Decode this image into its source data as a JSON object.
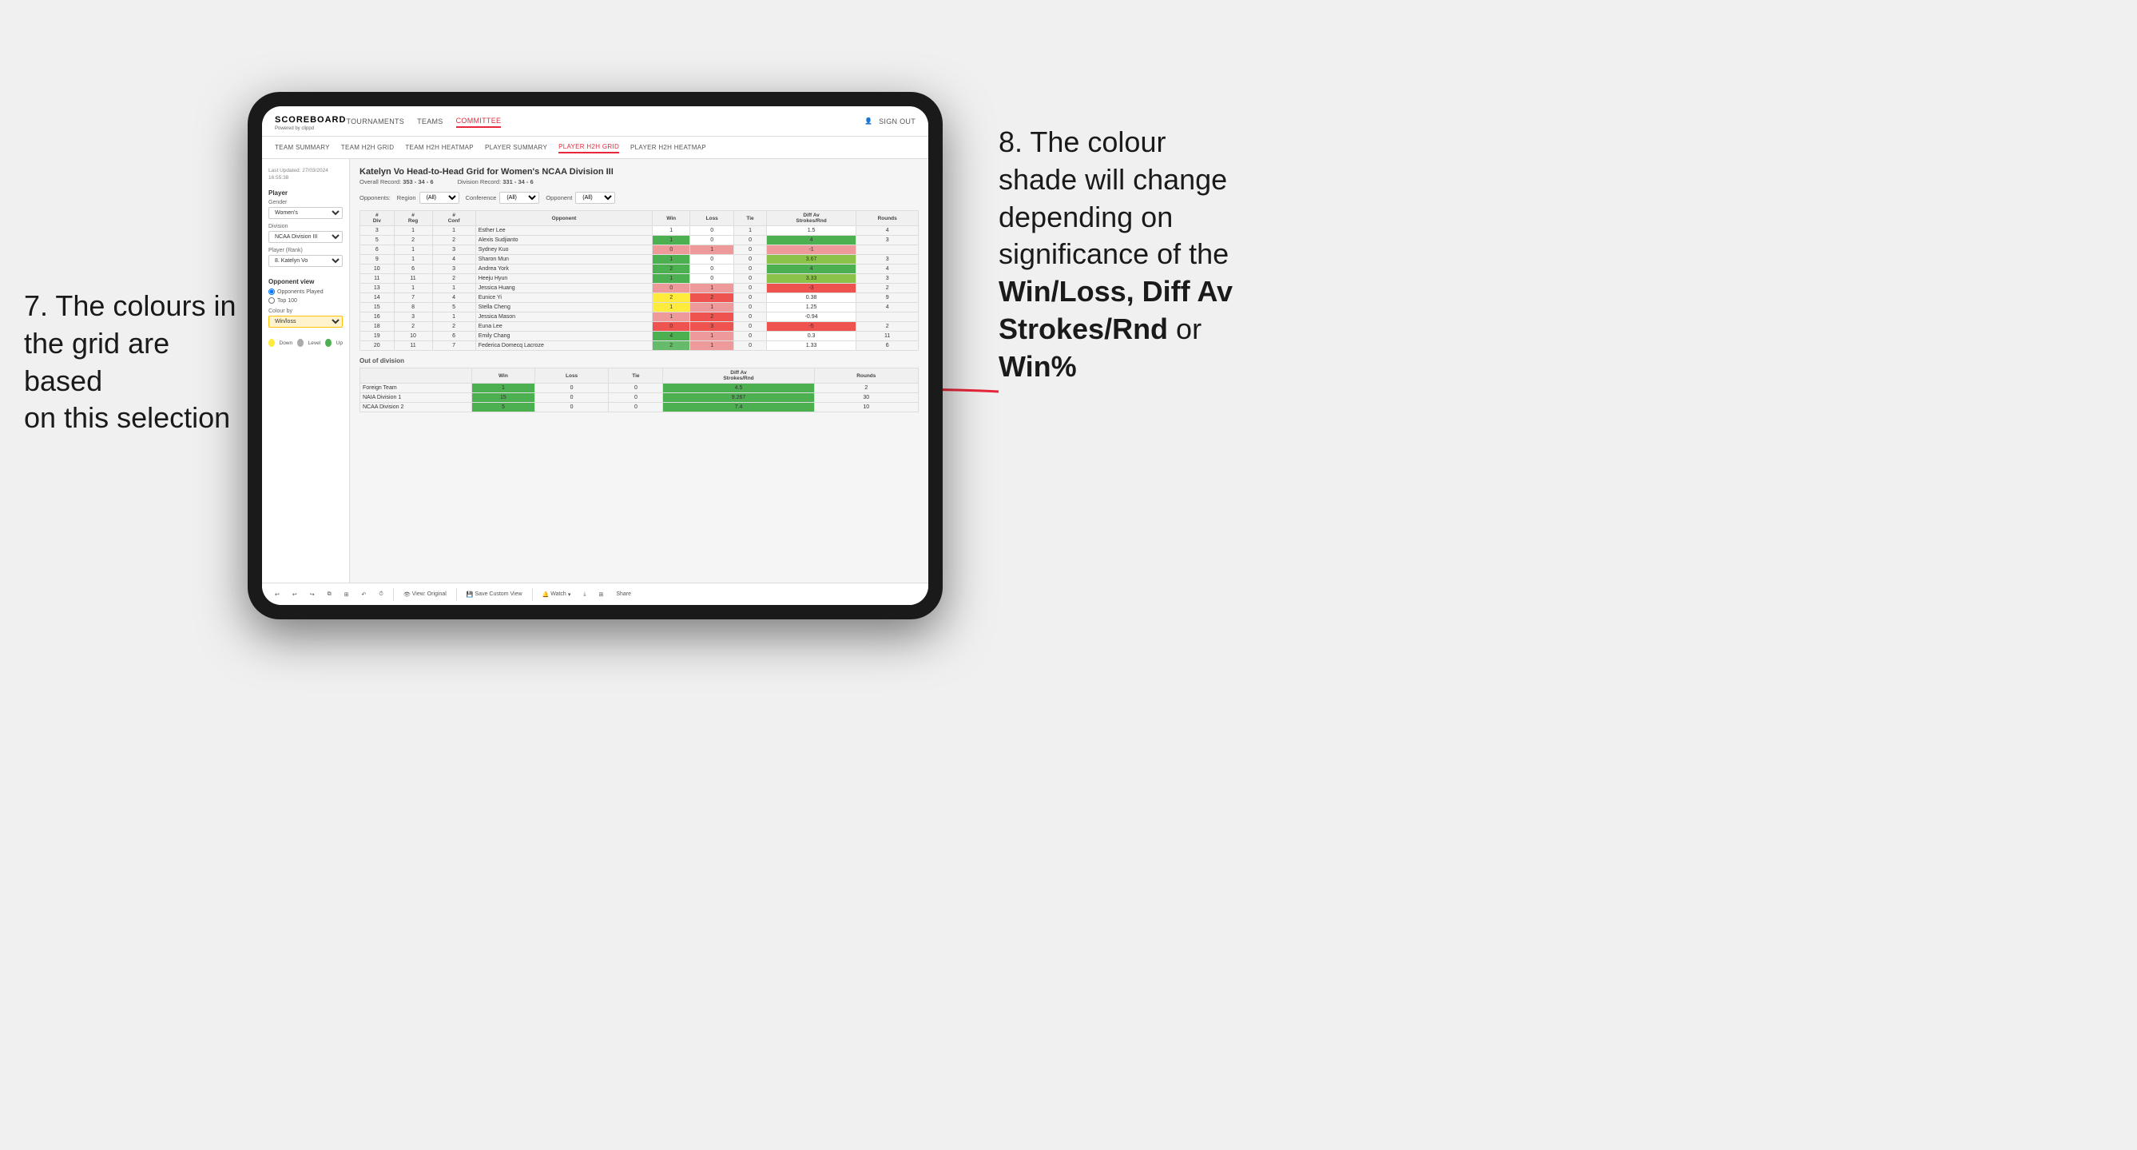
{
  "annotations": {
    "left_title": "7. The colours in\nthe grid are based\non this selection",
    "right_title_line1": "8. The colour",
    "right_title_line2": "shade will change",
    "right_title_line3": "depending on",
    "right_title_line4": "significance of the",
    "right_title_bold1": "Win/Loss,",
    "right_title_bold2": "Diff Av",
    "right_title_bold3": "Strokes/Rnd",
    "right_title_or": "or",
    "right_title_bold4": "Win%"
  },
  "app": {
    "logo": "SCOREBOARD",
    "logo_sub": "Powered by clippd",
    "sign_out": "Sign out",
    "nav": [
      "TOURNAMENTS",
      "TEAMS",
      "COMMITTEE"
    ],
    "active_nav": "COMMITTEE",
    "sub_nav": [
      "TEAM SUMMARY",
      "TEAM H2H GRID",
      "TEAM H2H HEATMAP",
      "PLAYER SUMMARY",
      "PLAYER H2H GRID",
      "PLAYER H2H HEATMAP"
    ],
    "active_sub_nav": "PLAYER H2H GRID"
  },
  "sidebar": {
    "timestamp": "Last Updated: 27/03/2024\n16:55:38",
    "sections": {
      "player": "Player",
      "gender_label": "Gender",
      "gender_value": "Women's",
      "division_label": "Division",
      "division_value": "NCAA Division III",
      "rank_label": "Player (Rank)",
      "rank_value": "8. Katelyn Vo",
      "opponent_view_label": "Opponent view",
      "opponent_played": "Opponents Played",
      "top_100": "Top 100",
      "colour_by_label": "Colour by",
      "colour_by_value": "Win/loss",
      "legend": {
        "down": "Down",
        "level": "Level",
        "up": "Up"
      }
    }
  },
  "grid": {
    "title": "Katelyn Vo Head-to-Head Grid for Women's NCAA Division III",
    "overall_record_label": "Overall Record:",
    "overall_record": "353 - 34 - 6",
    "division_record_label": "Division Record:",
    "division_record": "331 - 34 - 6",
    "filter_opponents_label": "Opponents:",
    "filter_region_label": "Region",
    "filter_conference_label": "Conference",
    "filter_opponent_label": "Opponent",
    "filter_all": "(All)",
    "columns": {
      "div": "#\nDiv",
      "reg": "#\nReg",
      "conf": "#\nConf",
      "opponent": "Opponent",
      "win": "Win",
      "loss": "Loss",
      "tie": "Tie",
      "diff_av": "Diff Av\nStrokes/Rnd",
      "rounds": "Rounds"
    },
    "rows": [
      {
        "div": 3,
        "reg": 1,
        "conf": 1,
        "opponent": "Esther Lee",
        "win": 1,
        "loss": 0,
        "tie": 1,
        "diff_av": 1.5,
        "rounds": 4,
        "win_bg": "bg-white",
        "diff_bg": "bg-white"
      },
      {
        "div": 5,
        "reg": 2,
        "conf": 2,
        "opponent": "Alexis Sudjianto",
        "win": 1,
        "loss": 0,
        "tie": 0,
        "diff_av": 4.0,
        "rounds": 3,
        "win_bg": "bg-green-dark",
        "diff_bg": "bg-green-dark"
      },
      {
        "div": 6,
        "reg": 1,
        "conf": 3,
        "opponent": "Sydney Kuo",
        "win": 0,
        "loss": 1,
        "tie": 0,
        "diff_av": -1.0,
        "rounds": "",
        "win_bg": "bg-red-light",
        "diff_bg": "bg-red-light"
      },
      {
        "div": 9,
        "reg": 1,
        "conf": 4,
        "opponent": "Sharon Mun",
        "win": 1,
        "loss": 0,
        "tie": 0,
        "diff_av": 3.67,
        "rounds": 3,
        "win_bg": "bg-green-dark",
        "diff_bg": "bg-green-light"
      },
      {
        "div": 10,
        "reg": 6,
        "conf": 3,
        "opponent": "Andrea York",
        "win": 2,
        "loss": 0,
        "tie": 0,
        "diff_av": 4.0,
        "rounds": 4,
        "win_bg": "bg-green-dark",
        "diff_bg": "bg-green-dark"
      },
      {
        "div": 11,
        "reg": 11,
        "conf": 2,
        "opponent": "Heeju Hyun",
        "win": 1,
        "loss": 0,
        "tie": 0,
        "diff_av": 3.33,
        "rounds": 3,
        "win_bg": "bg-green-dark",
        "diff_bg": "bg-green-light"
      },
      {
        "div": 13,
        "reg": 1,
        "conf": 1,
        "opponent": "Jessica Huang",
        "win": 0,
        "loss": 1,
        "tie": 0,
        "diff_av": -3.0,
        "rounds": 2,
        "win_bg": "bg-red-light",
        "diff_bg": "bg-red-dark"
      },
      {
        "div": 14,
        "reg": 7,
        "conf": 4,
        "opponent": "Eunice Yi",
        "win": 2,
        "loss": 2,
        "tie": 0,
        "diff_av": 0.38,
        "rounds": 9,
        "win_bg": "bg-yellow",
        "diff_bg": "bg-white"
      },
      {
        "div": 15,
        "reg": 8,
        "conf": 5,
        "opponent": "Stella Cheng",
        "win": 1,
        "loss": 1,
        "tie": 0,
        "diff_av": 1.25,
        "rounds": 4,
        "win_bg": "bg-yellow",
        "diff_bg": "bg-white"
      },
      {
        "div": 16,
        "reg": 3,
        "conf": 1,
        "opponent": "Jessica Mason",
        "win": 1,
        "loss": 2,
        "tie": 0,
        "diff_av": -0.94,
        "rounds": "",
        "win_bg": "bg-red-light",
        "diff_bg": "bg-white"
      },
      {
        "div": 18,
        "reg": 2,
        "conf": 2,
        "opponent": "Euna Lee",
        "win": 0,
        "loss": 3,
        "tie": 0,
        "diff_av": -5.0,
        "rounds": 2,
        "win_bg": "bg-red-dark",
        "diff_bg": "bg-red-dark"
      },
      {
        "div": 19,
        "reg": 10,
        "conf": 6,
        "opponent": "Emily Chang",
        "win": 4,
        "loss": 1,
        "tie": 0,
        "diff_av": 0.3,
        "rounds": 11,
        "win_bg": "bg-green-dark",
        "diff_bg": "bg-white"
      },
      {
        "div": 20,
        "reg": 11,
        "conf": 7,
        "opponent": "Federica Domecq Lacroze",
        "win": 2,
        "loss": 1,
        "tie": 0,
        "diff_av": 1.33,
        "rounds": 6,
        "win_bg": "bg-green-medium",
        "diff_bg": "bg-white"
      }
    ],
    "out_of_division_label": "Out of division",
    "out_rows": [
      {
        "label": "Foreign Team",
        "win": 1,
        "loss": 0,
        "tie": 0,
        "diff_av": 4.5,
        "rounds": 2,
        "win_bg": "bg-green-dark",
        "diff_bg": "bg-green-dark"
      },
      {
        "label": "NAIA Division 1",
        "win": 15,
        "loss": 0,
        "tie": 0,
        "diff_av": 9.267,
        "rounds": 30,
        "win_bg": "bg-green-dark",
        "diff_bg": "bg-green-dark"
      },
      {
        "label": "NCAA Division 2",
        "win": 5,
        "loss": 0,
        "tie": 0,
        "diff_av": 7.4,
        "rounds": 10,
        "win_bg": "bg-green-dark",
        "diff_bg": "bg-green-dark"
      }
    ]
  },
  "toolbar": {
    "view_original": "View: Original",
    "save_custom_view": "Save Custom View",
    "watch": "Watch",
    "share": "Share"
  }
}
